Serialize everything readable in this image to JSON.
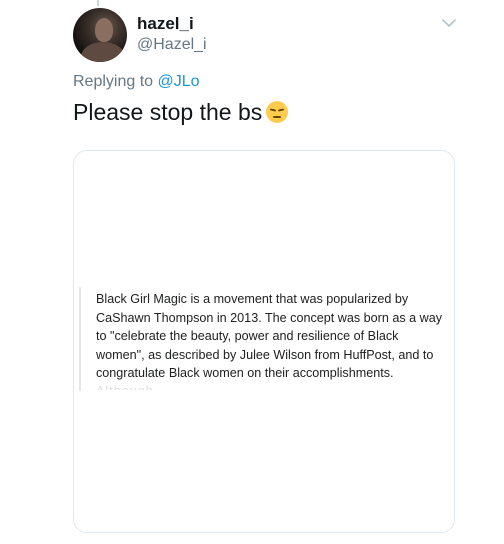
{
  "tweet": {
    "display_name": "hazel_i",
    "handle": "@Hazel_i",
    "replying_prefix": "Replying to ",
    "replying_to": "@JLo",
    "text": "Please stop the bs",
    "emoji": "pensive-face-emoji",
    "icons": {
      "menu": "chevron-down-icon"
    },
    "colors": {
      "link": "#1b95e0",
      "secondary_text": "#657786",
      "primary_text": "#14171a",
      "card_border": "#e1e8ed"
    }
  },
  "card": {
    "quote": "Black Girl Magic is a movement that was popularized by CaShawn Thompson in 2013. The concept was born as a way to \"celebrate the beauty, power and resilience of Black women\", as described by Julee Wilson from HuffPost, and to congratulate Black women on their accomplishments.",
    "quote_cutoff": "Although"
  }
}
